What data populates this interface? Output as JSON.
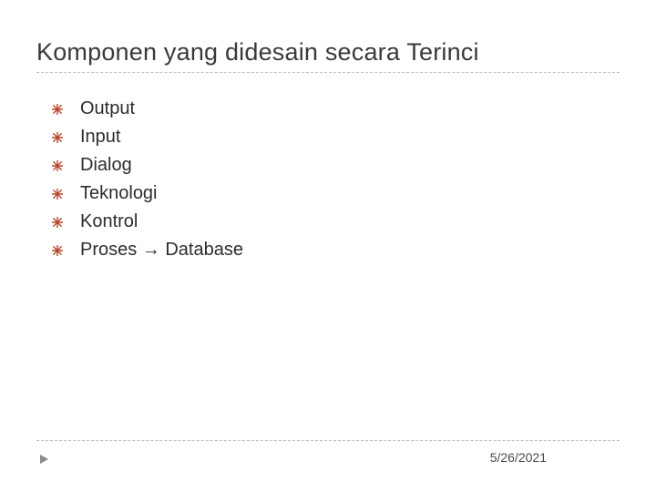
{
  "title": "Komponen yang didesain secara Terinci",
  "items": [
    "Output",
    "Input",
    "Dialog",
    "Teknologi",
    "Kontrol",
    "Proses → Database"
  ],
  "footer": {
    "date": "5/26/2021"
  },
  "colors": {
    "bullet": "#b5472e",
    "footer_mark": "#8a8a8a"
  }
}
